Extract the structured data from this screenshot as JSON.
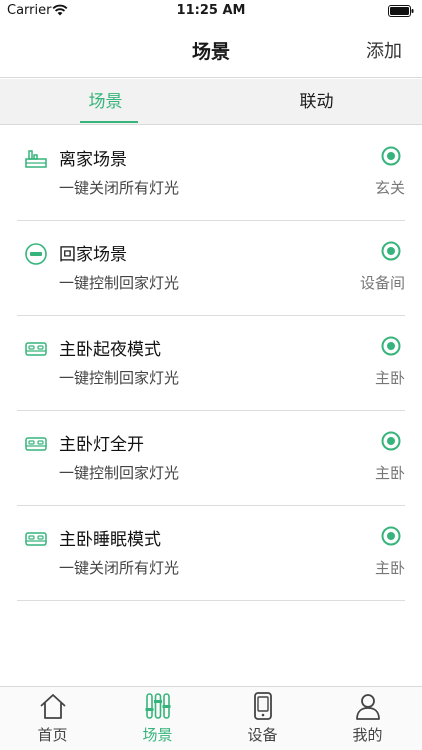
{
  "status_bar": {
    "carrier": "Carrier",
    "time": "11:25 AM"
  },
  "nav": {
    "title": "场景",
    "add_label": "添加"
  },
  "tabs": [
    {
      "label": "场景",
      "active": true
    },
    {
      "label": "联动",
      "active": false
    }
  ],
  "scenes": [
    {
      "icon": "luggage-icon",
      "name": "离家场景",
      "desc": "一键关闭所有灯光",
      "room": "玄关"
    },
    {
      "icon": "minus-circle-icon",
      "name": "回家场景",
      "desc": "一键控制回家灯光",
      "room": "设备间"
    },
    {
      "icon": "bed-icon",
      "name": "主卧起夜模式",
      "desc": "一键控制回家灯光",
      "room": "主卧"
    },
    {
      "icon": "bed-icon",
      "name": "主卧灯全开",
      "desc": "一键控制回家灯光",
      "room": "主卧"
    },
    {
      "icon": "bed-icon",
      "name": "主卧睡眠模式",
      "desc": "一键关闭所有灯光",
      "room": "主卧"
    }
  ],
  "tab_bar": [
    {
      "icon": "home-icon",
      "label": "首页",
      "active": false
    },
    {
      "icon": "sliders-icon",
      "label": "场景",
      "active": true
    },
    {
      "icon": "device-icon",
      "label": "设备",
      "active": false
    },
    {
      "icon": "user-icon",
      "label": "我的",
      "active": false
    }
  ],
  "colors": {
    "accent": "#37b47b",
    "divider": "#dcdcdc",
    "tab_background": "#f2f2f2"
  }
}
